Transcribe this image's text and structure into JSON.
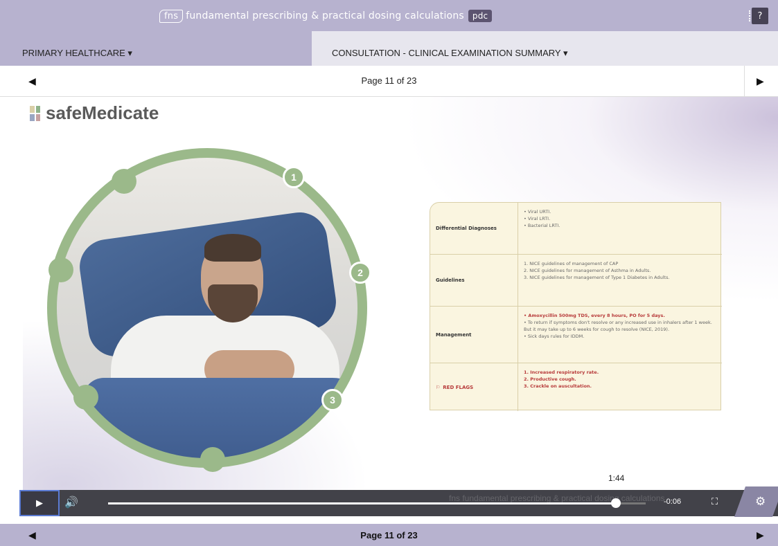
{
  "header": {
    "brand_fns": "fns",
    "brand_title": "fundamental prescribing & practical dosing calculations",
    "brand_badge": "pdc",
    "help_label": "?"
  },
  "menu": {
    "left_label": "PRIMARY HEALTHCARE ▾",
    "right_label": "CONSULTATION - CLINICAL EXAMINATION SUMMARY ▾"
  },
  "pager_top": {
    "label": "Page 11 of 23",
    "prev": "◀",
    "next": "▶"
  },
  "slide": {
    "logo_text": "safeMedicate",
    "markers": [
      "1",
      "2",
      "3"
    ],
    "table": {
      "rows": [
        {
          "heading": "Differential Diagnoses",
          "items": [
            "• Viral URTI.",
            "• Viral LRTI.",
            "• Bacterial LRTI."
          ]
        },
        {
          "heading": "Guidelines",
          "items": [
            "1. NICE guidelines of management of CAP",
            "2. NICE guidelines for management of Asthma in Adults.",
            "3. NICE guidelines for management of Type 1 Diabetes in Adults."
          ]
        },
        {
          "heading": "Management",
          "items": [
            "• Amoxycillin 500mg TDS, every 8 hours, PO for 5 days.",
            "• To return if symptoms don't resolve or any increased use in inhalers after 1 week. But it may take up to 6 weeks for cough to resolve (NICE, 2019).",
            "• Sick days rules for IDDM."
          ]
        },
        {
          "heading": "RED FLAGS",
          "items": [
            "1. Increased respiratory rate.",
            "2. Productive cough.",
            "3. Crackle on auscultation."
          ]
        }
      ]
    }
  },
  "player": {
    "play_icon": "▶",
    "volume_icon": "🔊",
    "tooltip_time": "1:44",
    "remaining_time": "-0:06",
    "fullscreen_icon": "⛶",
    "settings_icon": "⚙",
    "watermark": "fns fundamental prescribing & practical dosing calculations",
    "progress": 0.945
  },
  "pager_bottom": {
    "label": "Page 11 of 23",
    "prev": "◀",
    "next": "▶"
  }
}
